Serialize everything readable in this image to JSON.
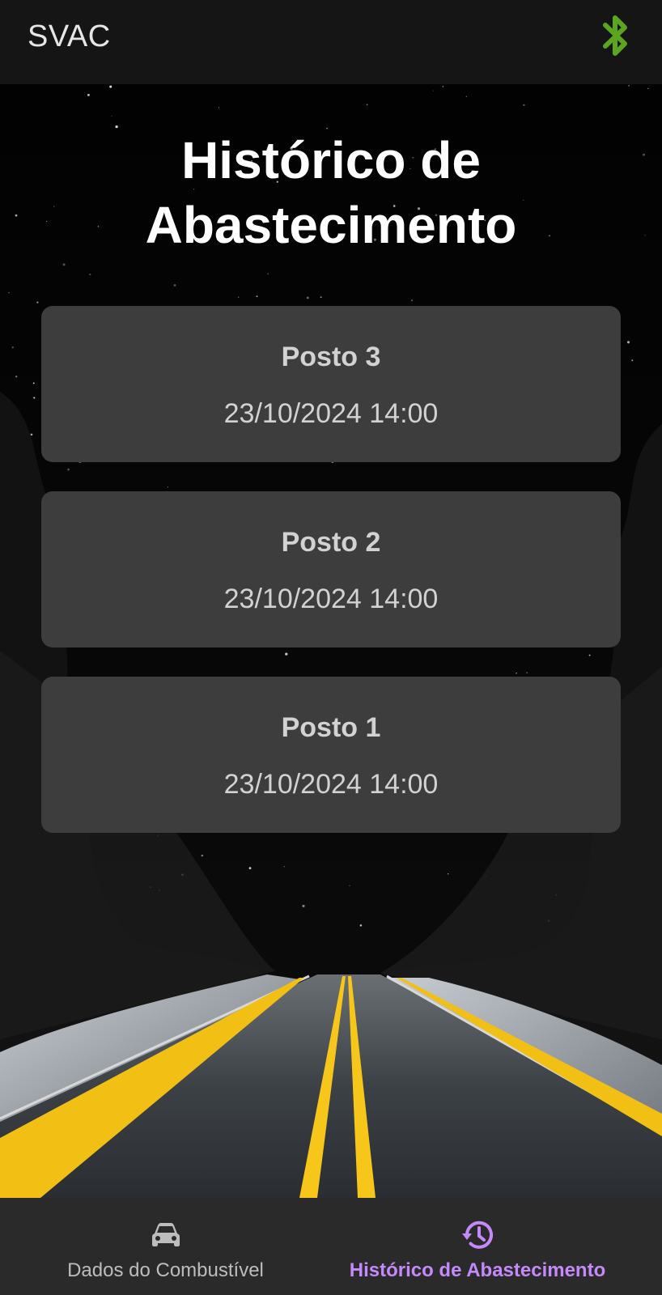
{
  "app_bar": {
    "title": "SVAC",
    "bluetooth_icon": "bluetooth-icon",
    "bluetooth_color": "#5ba61e"
  },
  "page": {
    "heading_line1": "Histórico de",
    "heading_line2": "Abastecimento"
  },
  "history": [
    {
      "station": "Posto 3",
      "datetime": "23/10/2024 14:00"
    },
    {
      "station": "Posto 2",
      "datetime": "23/10/2024 14:00"
    },
    {
      "station": "Posto 1",
      "datetime": "23/10/2024 14:00"
    }
  ],
  "bottom_nav": {
    "items": [
      {
        "label": "Dados do Combustível",
        "icon": "car-icon",
        "active": false
      },
      {
        "label": "Histórico de Abastecimento",
        "icon": "history-icon",
        "active": true
      }
    ],
    "active_color": "#c58af9"
  }
}
